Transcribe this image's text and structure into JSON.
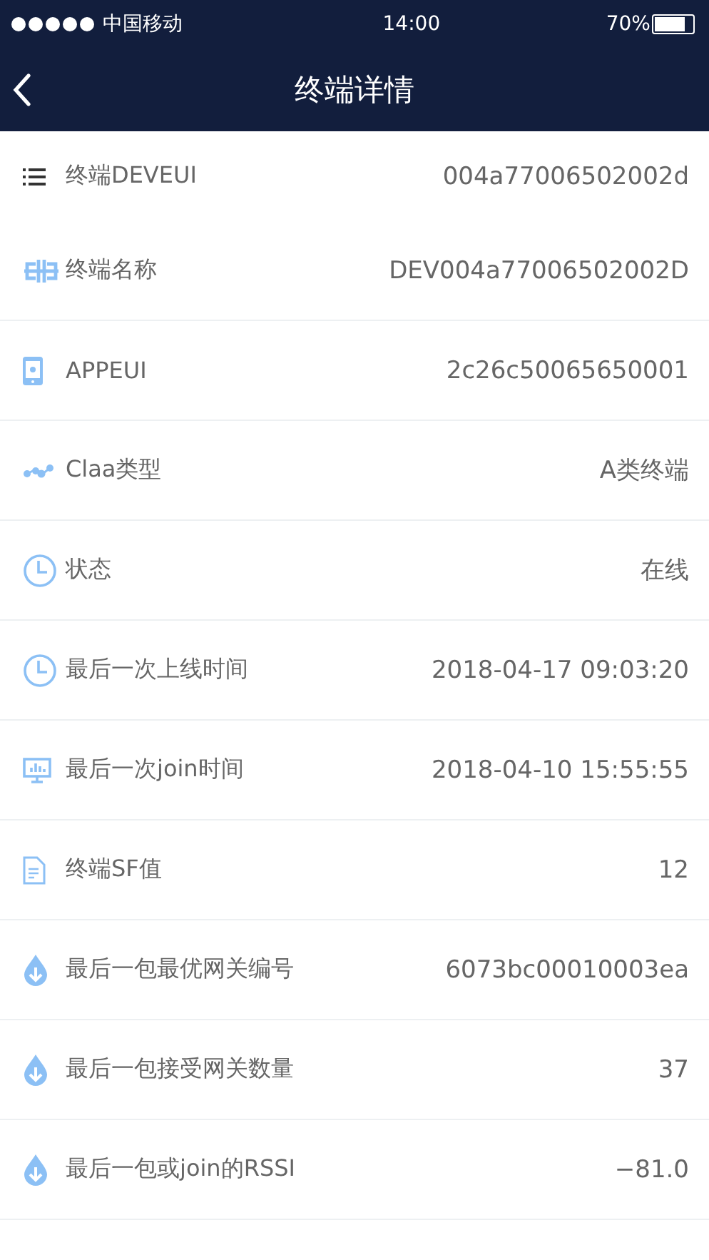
{
  "status_bar": {
    "carrier": "中国移动",
    "time": "14:00",
    "battery": "70%"
  },
  "nav": {
    "title": "终端详情"
  },
  "rows": [
    {
      "kind": "list",
      "label": "终端DEVEUI",
      "value": "004a77006502002d"
    },
    {
      "kind": "connector",
      "label": "终端名称",
      "value": "DEV004a77006502002D"
    },
    {
      "kind": "phone",
      "label": "APPEUI",
      "value": "2c26c50065650001"
    },
    {
      "kind": "dots",
      "label": "Claa类型",
      "value": "A类终端"
    },
    {
      "kind": "clock",
      "label": "状态",
      "value": "在线"
    },
    {
      "kind": "clock",
      "label": "最后一次上线时间",
      "value": "2018-04-17 09:03:20"
    },
    {
      "kind": "monitor",
      "label": "最后一次join时间",
      "value": "2018-04-10 15:55:55"
    },
    {
      "kind": "document",
      "label": "终端SF值",
      "value": "12"
    },
    {
      "kind": "drop",
      "label": "最后一包最优网关编号",
      "value": "6073bc00010003ea"
    },
    {
      "kind": "drop",
      "label": "最后一包接受网关数量",
      "value": "37"
    },
    {
      "kind": "drop",
      "label": "最后一包或join的RSSI",
      "value": "−81.0"
    }
  ]
}
